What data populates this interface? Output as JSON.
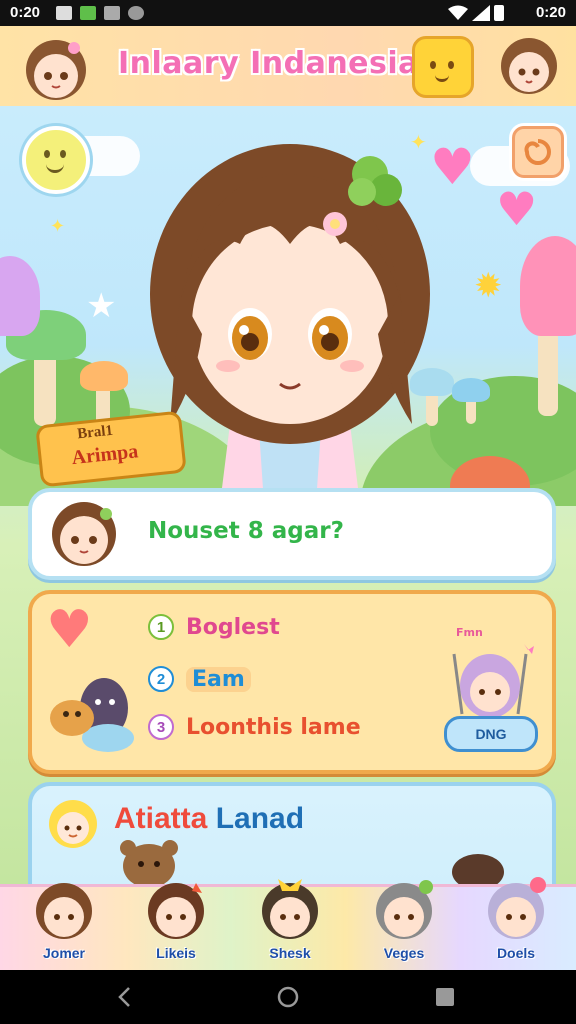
{
  "status_bar": {
    "time_left": "0:20",
    "time_right": "0:20"
  },
  "header": {
    "title": "Inlaary Indanesia"
  },
  "hero": {
    "sign_line1": "Bral1",
    "sign_line2": "Arimpa"
  },
  "message_card": {
    "text": "Nouset 8 agar?"
  },
  "menu": {
    "items": [
      {
        "num": "1",
        "label": "Boglest",
        "color": "#e0488f"
      },
      {
        "num": "2",
        "label": "Eam",
        "color": "#1f8dd6"
      },
      {
        "num": "3",
        "label": "Loonthis lame",
        "color": "#e8502f"
      }
    ],
    "play_label": "Fmn",
    "play_button": "DNG"
  },
  "land_card": {
    "title_a": "Atiatta",
    "title_b": "Lanad"
  },
  "tabs": [
    {
      "label": "Jomer"
    },
    {
      "label": "Likeis"
    },
    {
      "label": "Shesk"
    },
    {
      "label": "Veges"
    },
    {
      "label": "Doels"
    }
  ],
  "colors": {
    "accent_pink": "#f46fb5",
    "header_bg": "#ffe3a6",
    "menu_border": "#f0a94c"
  }
}
